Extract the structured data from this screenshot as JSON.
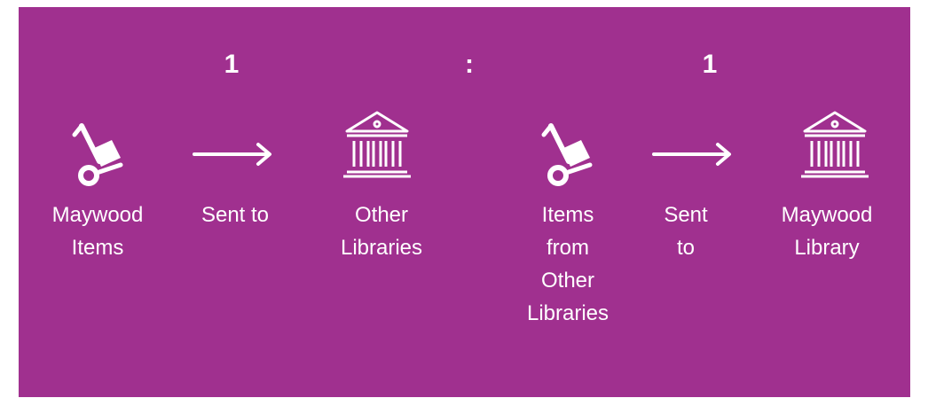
{
  "ratio": {
    "left": "1",
    "separator": ":",
    "right": "1"
  },
  "flows": [
    {
      "source_label": "Maywood\nItems",
      "verb_label": "Sent to",
      "target_label": "Other\nLibraries",
      "source_icon": "hand-truck-icon",
      "arrow_icon": "right-arrow-icon",
      "target_icon": "library-building-icon"
    },
    {
      "source_label": "Items\nfrom\nOther\nLibraries",
      "verb_label": "Sent\nto",
      "target_label": "Maywood\nLibrary",
      "source_icon": "hand-truck-icon",
      "arrow_icon": "right-arrow-icon",
      "target_icon": "library-building-icon"
    }
  ],
  "colors": {
    "background": "#a0308f",
    "foreground": "#ffffff"
  }
}
